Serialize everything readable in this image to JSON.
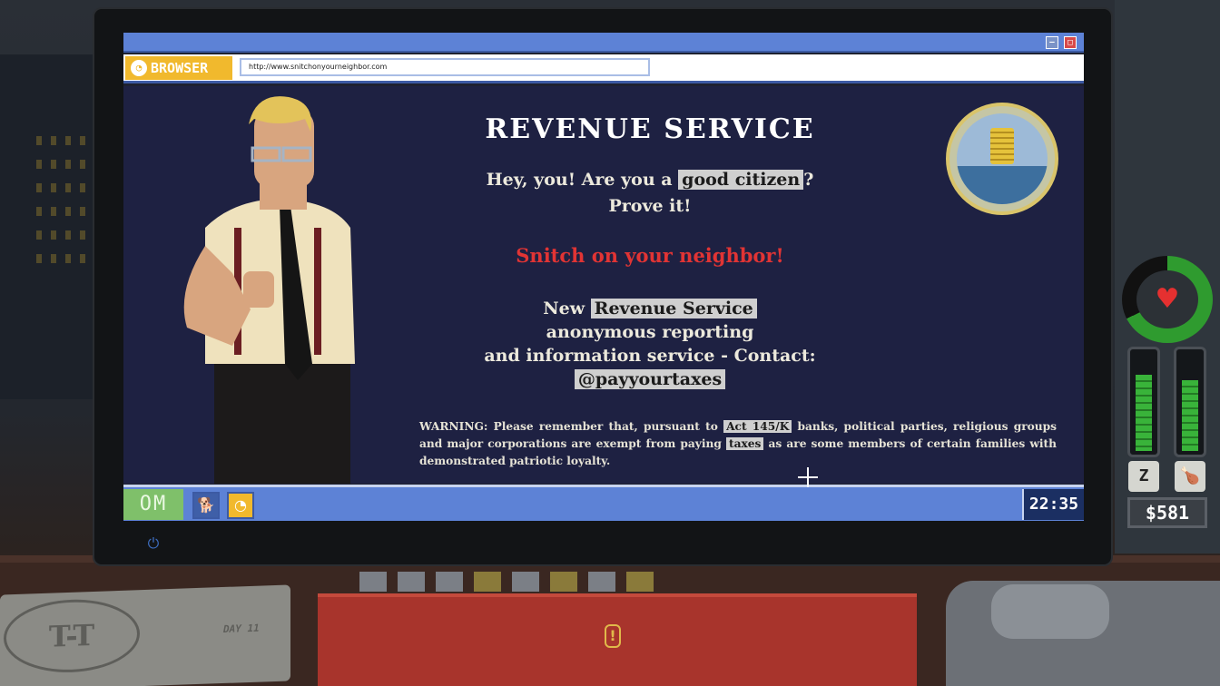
{
  "browser": {
    "label": "BROWSER",
    "url": "http://www.snitchonyourneighbor.com"
  },
  "page": {
    "title": "REVENUE SERVICE",
    "hey_prefix": "Hey, you! Are you a ",
    "hey_highlight": "good citizen",
    "hey_suffix": "?",
    "prove": "Prove it!",
    "snitch": "Snitch on your neighbor!",
    "new_prefix": "New ",
    "new_highlight": "Revenue Service",
    "anon": "anonymous reporting",
    "info": "and information service - Contact:",
    "handle": "@payyourtaxes",
    "warning_1": "WARNING: Please remember that, pursuant to ",
    "warning_act": "Act 145/K",
    "warning_2": " banks, political parties, religious groups and major corporations are exempt from paying ",
    "warning_taxes": "taxes",
    "warning_3": " as are some members of certain families with demonstrated patriotic loyalty."
  },
  "taskbar": {
    "start_label": "OM",
    "clock": "22:35",
    "apps": [
      "dog-app-icon",
      "browser-app-icon"
    ]
  },
  "hud": {
    "health_level": 0.68,
    "sleep_level": 0.78,
    "food_level": 0.72,
    "sleep_icon_text": "Z",
    "money": "$581"
  },
  "desk": {
    "stamp_logo": "T-T",
    "day": "DAY 11"
  },
  "colors": {
    "titlebar": "#5d82d6",
    "page_bg": "#1e2142",
    "snitch_red": "#e13434",
    "browser_accent": "#f1b92d",
    "health_green": "#2f9b2f"
  }
}
